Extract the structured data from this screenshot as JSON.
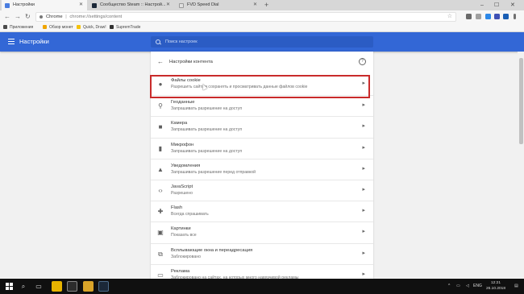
{
  "browser": {
    "tabs": [
      {
        "title": "Настройки",
        "active": true,
        "icon_color": "#4a7de0"
      },
      {
        "title": "Сообщество Steam :: Настрой...",
        "active": false,
        "icon_color": "#1b2838"
      },
      {
        "title": "FVD Speed Dial",
        "active": false,
        "icon_color": "#e0e0e0"
      }
    ],
    "new_tab_symbol": "+",
    "window_controls": {
      "minimize": "–",
      "maximize": "☐",
      "close": "✕"
    },
    "nav": {
      "back": "←",
      "forward": "→",
      "reload": "↻"
    },
    "address": {
      "host": "Chrome",
      "separator": "|",
      "url": "chrome://settings/content"
    },
    "star": "☆",
    "extension_colors": [
      "#6a6a6a",
      "#a0a0a0",
      "#2d88e8",
      "#3f51b5",
      "#1a5fb4",
      "#707070"
    ],
    "bookmarks": [
      {
        "label": "Приложения",
        "icon_color": "#4a4a4a"
      },
      {
        "label": "Обзор монет",
        "icon_color": "#f0a500"
      },
      {
        "label": "Quick, Draw!",
        "icon_color": "#f4c20d"
      },
      {
        "label": "SupremTrade",
        "icon_color": "#333333"
      }
    ]
  },
  "header": {
    "title": "Настройки",
    "search_placeholder": "Поиск настроек",
    "color": "#3367d6"
  },
  "content": {
    "back_symbol": "←",
    "title": "Настройки контента",
    "help_symbol": "?",
    "chevron": "▸",
    "items": [
      {
        "icon": "cookie-icon",
        "glyph": "●",
        "title": "Файлы cookie",
        "subtitle": "Разрешить сайтам сохранять и просматривать данные файлов cookie"
      },
      {
        "icon": "location-icon",
        "glyph": "⚲",
        "title": "Геоданные",
        "subtitle": "Запрашивать разрешение на доступ"
      },
      {
        "icon": "camera-icon",
        "glyph": "■",
        "title": "Камера",
        "subtitle": "Запрашивать разрешение на доступ"
      },
      {
        "icon": "microphone-icon",
        "glyph": "▮",
        "title": "Микрофон",
        "subtitle": "Запрашивать разрешение на доступ"
      },
      {
        "icon": "bell-icon",
        "glyph": "▲",
        "title": "Уведомления",
        "subtitle": "Запрашивать разрешение перед отправкой"
      },
      {
        "icon": "code-icon",
        "glyph": "‹›",
        "title": "JavaScript",
        "subtitle": "Разрешено"
      },
      {
        "icon": "puzzle-icon",
        "glyph": "✚",
        "title": "Flash",
        "subtitle": "Всегда спрашивать"
      },
      {
        "icon": "image-icon",
        "glyph": "▣",
        "title": "Картинки",
        "subtitle": "Показать все"
      },
      {
        "icon": "popup-icon",
        "glyph": "⧉",
        "title": "Всплывающие окна и переадресация",
        "subtitle": "Заблокировано"
      },
      {
        "icon": "ads-icon",
        "glyph": "▭",
        "title": "Реклама",
        "subtitle": "Заблокировано на сайтах, на которых много навязчивой рекламы"
      }
    ]
  },
  "taskbar": {
    "search_glyph": "⌕",
    "taskview_glyph": "▭",
    "apps": [
      {
        "name": "chrome",
        "color": "#e8b400"
      },
      {
        "name": "app2",
        "color": "#2c2c2c"
      },
      {
        "name": "explorer",
        "color": "#d9a429"
      },
      {
        "name": "steam",
        "color": "#1b2838"
      }
    ],
    "tray": {
      "language": "ENG",
      "time": "12:21",
      "date": "26.10.2018"
    }
  }
}
